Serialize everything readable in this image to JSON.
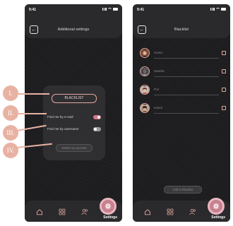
{
  "status": {
    "time": "9:41"
  },
  "screen_left": {
    "title": "Additional settings",
    "back_glyph": "←",
    "blacklist_button": "BLACKLIST",
    "toggle_email_label": "Find me by e-mail",
    "toggle_email_on": true,
    "toggle_username_label": "Find me by username",
    "toggle_username_on": false,
    "delete_button": "Delete my account"
  },
  "screen_right": {
    "title": "Blacklist",
    "back_glyph": "←",
    "contacts": [
      {
        "name": "Sonia"
      },
      {
        "name": "Sandra"
      },
      {
        "name": "Pol"
      },
      {
        "name": "Karen"
      }
    ],
    "add_button": "Add to blacklist"
  },
  "tabbar": {
    "tabs": [
      "home-icon",
      "grid-icon",
      "users-icon"
    ],
    "settings_label": "Settings"
  },
  "markers": [
    "I.",
    "II.",
    "III.",
    "IV."
  ],
  "colors": {
    "accent": "#e3a79b",
    "fab": "#c7808f",
    "background": "#1c1c1e",
    "card": "#2f2f32"
  }
}
